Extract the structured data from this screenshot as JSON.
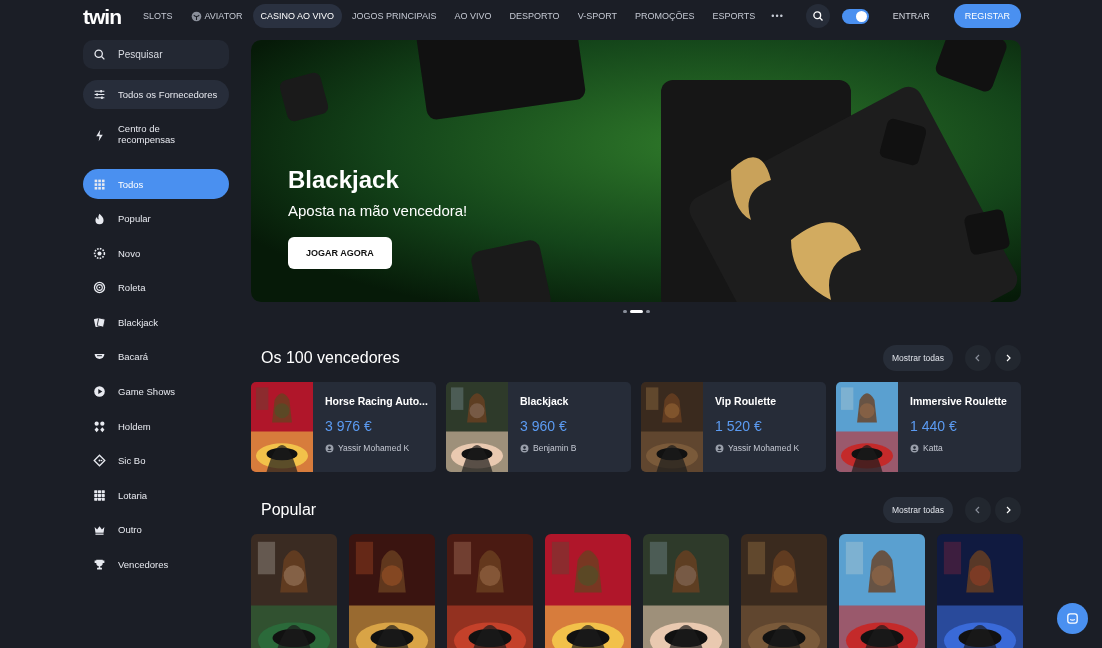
{
  "header": {
    "logo": "twin",
    "nav": [
      {
        "label": "SLOTS",
        "selected": false
      },
      {
        "label": "AVIATOR",
        "selected": false,
        "kind": "icon"
      },
      {
        "label": "CASINO AO VIVO",
        "selected": true
      },
      {
        "label": "JOGOS PRINCIPAIS",
        "selected": false
      },
      {
        "label": "AO VIVO",
        "selected": false
      },
      {
        "label": "DESPORTO",
        "selected": false
      },
      {
        "label": "V-SPORT",
        "selected": false
      },
      {
        "label": "PROMOÇÕES",
        "selected": false
      },
      {
        "label": "ESPORTS",
        "selected": false
      }
    ],
    "more": "•••",
    "theme_toggle": {
      "on": true
    },
    "login": "ENTRAR",
    "register": "REGISTAR"
  },
  "sidebar": {
    "search": {
      "placeholder": "Pesquisar"
    },
    "providers": "Todos os Fornecedores",
    "rewards": "Centro de recompensas",
    "items": [
      {
        "label": "Todos",
        "selected": true
      },
      {
        "label": "Popular",
        "selected": false
      },
      {
        "label": "Novo",
        "selected": false
      },
      {
        "label": "Roleta",
        "selected": false
      },
      {
        "label": "Blackjack",
        "selected": false
      },
      {
        "label": "Bacará",
        "selected": false
      },
      {
        "label": "Game Shows",
        "selected": false
      },
      {
        "label": "Holdem",
        "selected": false
      },
      {
        "label": "Sic Bo",
        "selected": false
      },
      {
        "label": "Lotaria",
        "selected": false
      },
      {
        "label": "Outro",
        "selected": false
      },
      {
        "label": "Vencedores",
        "selected": false
      }
    ]
  },
  "banner": {
    "title": "Blackjack",
    "subtitle": "Aposta na mão vencedora!",
    "button": "JOGAR AGORA",
    "dots": [
      {
        "selected": false
      },
      {
        "selected": true
      },
      {
        "selected": false
      }
    ]
  },
  "winners": {
    "title": "Os 100 vencedores",
    "show_all": "Mostrar todas",
    "cards": [
      {
        "game": "Horse Racing Auto...",
        "amount": "3 976 €",
        "user": "Yassir Mohamed K"
      },
      {
        "game": "Blackjack",
        "amount": "3 960 €",
        "user": "Benjamin B"
      },
      {
        "game": "Vip Roulette",
        "amount": "1 520 €",
        "user": "Yassir Mohamed K"
      },
      {
        "game": "Immersive Roulette",
        "amount": "1 440 €",
        "user": "Katta"
      }
    ]
  },
  "popular": {
    "title": "Popular",
    "show_all": "Mostrar todas"
  }
}
